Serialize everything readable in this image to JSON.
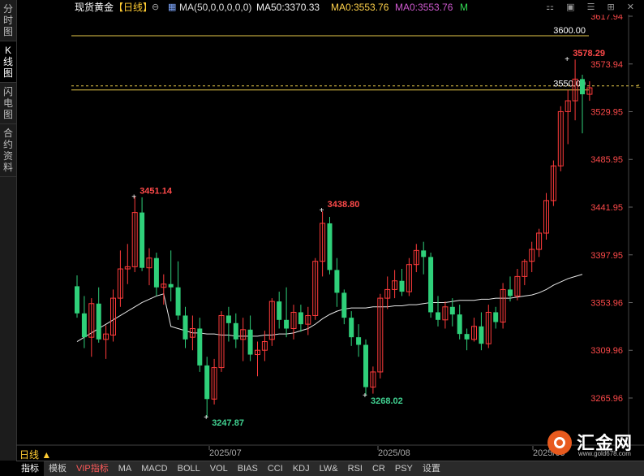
{
  "side_tabs": [
    {
      "label": [
        "分",
        "时",
        "图"
      ],
      "active": false
    },
    {
      "label": [
        "K",
        "线",
        "图"
      ],
      "active": true
    },
    {
      "label": [
        "闪",
        "电",
        "图"
      ],
      "active": false
    },
    {
      "label": [
        "合",
        "约",
        "资",
        "料"
      ],
      "active": false
    }
  ],
  "header": {
    "symbol": "现货黄金",
    "period": "【日线】",
    "ma_params": "MA(50,0,0,0,0,0)",
    "ma50": "MA50:3370.33",
    "ma0_a": "MA0:3553.76",
    "ma0_b": "MA0:3553.76",
    "m_label": "M"
  },
  "price_axis_labels": [
    "3617.94",
    "3573.94",
    "3529.95",
    "3485.95",
    "3441.95",
    "3397.95",
    "3353.96",
    "3309.96",
    "3265.96"
  ],
  "annotations": {
    "high1": "3451.14",
    "high2": "3438.80",
    "low1": "3247.87",
    "low2": "3268.02",
    "peak": "3578.29",
    "line_3600": "3600.00",
    "line_3550": "3550.00"
  },
  "date_labels": [
    "2025/07",
    "2025/08",
    "2025/09"
  ],
  "period_button": "日线 ▲",
  "bottom_tabs": [
    "指标",
    "模板",
    "VIP指标",
    "MA",
    "MACD",
    "BOLL",
    "VOL",
    "BIAS",
    "CCI",
    "KDJ",
    "LW&",
    "RSI",
    "CR",
    "PSY",
    "设置"
  ],
  "logo": {
    "name": "汇金网",
    "url": "www.gold678.com"
  },
  "colors": {
    "up": "#ff3b3b",
    "down": "#2fd07a",
    "ma50": "#e8e8e8",
    "axis_text": "#ff4a4a",
    "annotation_low": "#40d090",
    "line_level": "#e6c84a"
  },
  "chart_data": {
    "type": "candlestick",
    "title": "现货黄金 日线",
    "ylim": [
      3230,
      3630
    ],
    "candles": [
      {
        "o": 3369,
        "h": 3379,
        "l": 3340,
        "c": 3344
      },
      {
        "o": 3344,
        "h": 3360,
        "l": 3312,
        "c": 3322
      },
      {
        "o": 3322,
        "h": 3358,
        "l": 3304,
        "c": 3353
      },
      {
        "o": 3353,
        "h": 3368,
        "l": 3317,
        "c": 3320
      },
      {
        "o": 3320,
        "h": 3333,
        "l": 3302,
        "c": 3325
      },
      {
        "o": 3324,
        "h": 3366,
        "l": 3318,
        "c": 3358
      },
      {
        "o": 3358,
        "h": 3402,
        "l": 3350,
        "c": 3385
      },
      {
        "o": 3385,
        "h": 3408,
        "l": 3371,
        "c": 3387
      },
      {
        "o": 3387,
        "h": 3452,
        "l": 3382,
        "c": 3437
      },
      {
        "o": 3437,
        "h": 3451,
        "l": 3383,
        "c": 3386
      },
      {
        "o": 3386,
        "h": 3404,
        "l": 3370,
        "c": 3395
      },
      {
        "o": 3395,
        "h": 3400,
        "l": 3360,
        "c": 3368
      },
      {
        "o": 3368,
        "h": 3380,
        "l": 3352,
        "c": 3371
      },
      {
        "o": 3371,
        "h": 3402,
        "l": 3355,
        "c": 3368
      },
      {
        "o": 3368,
        "h": 3392,
        "l": 3338,
        "c": 3342
      },
      {
        "o": 3342,
        "h": 3350,
        "l": 3312,
        "c": 3320
      },
      {
        "o": 3322,
        "h": 3342,
        "l": 3310,
        "c": 3330
      },
      {
        "o": 3330,
        "h": 3340,
        "l": 3290,
        "c": 3296
      },
      {
        "o": 3296,
        "h": 3304,
        "l": 3248,
        "c": 3265
      },
      {
        "o": 3265,
        "h": 3302,
        "l": 3260,
        "c": 3294
      },
      {
        "o": 3294,
        "h": 3346,
        "l": 3290,
        "c": 3342
      },
      {
        "o": 3342,
        "h": 3350,
        "l": 3318,
        "c": 3335
      },
      {
        "o": 3335,
        "h": 3344,
        "l": 3312,
        "c": 3320
      },
      {
        "o": 3320,
        "h": 3340,
        "l": 3300,
        "c": 3329
      },
      {
        "o": 3329,
        "h": 3342,
        "l": 3300,
        "c": 3306
      },
      {
        "o": 3306,
        "h": 3318,
        "l": 3286,
        "c": 3310
      },
      {
        "o": 3310,
        "h": 3328,
        "l": 3300,
        "c": 3318
      },
      {
        "o": 3320,
        "h": 3358,
        "l": 3314,
        "c": 3355
      },
      {
        "o": 3355,
        "h": 3364,
        "l": 3330,
        "c": 3338
      },
      {
        "o": 3338,
        "h": 3368,
        "l": 3322,
        "c": 3330
      },
      {
        "o": 3330,
        "h": 3352,
        "l": 3320,
        "c": 3345
      },
      {
        "o": 3345,
        "h": 3352,
        "l": 3327,
        "c": 3334
      },
      {
        "o": 3334,
        "h": 3350,
        "l": 3324,
        "c": 3342
      },
      {
        "o": 3342,
        "h": 3395,
        "l": 3338,
        "c": 3392
      },
      {
        "o": 3392,
        "h": 3438,
        "l": 3378,
        "c": 3427
      },
      {
        "o": 3427,
        "h": 3433,
        "l": 3380,
        "c": 3384
      },
      {
        "o": 3384,
        "h": 3395,
        "l": 3350,
        "c": 3363
      },
      {
        "o": 3363,
        "h": 3366,
        "l": 3334,
        "c": 3340
      },
      {
        "o": 3340,
        "h": 3346,
        "l": 3314,
        "c": 3322
      },
      {
        "o": 3322,
        "h": 3334,
        "l": 3304,
        "c": 3315
      },
      {
        "o": 3315,
        "h": 3320,
        "l": 3268,
        "c": 3276
      },
      {
        "o": 3276,
        "h": 3295,
        "l": 3270,
        "c": 3290
      },
      {
        "o": 3290,
        "h": 3362,
        "l": 3284,
        "c": 3358
      },
      {
        "o": 3358,
        "h": 3378,
        "l": 3348,
        "c": 3366
      },
      {
        "o": 3366,
        "h": 3384,
        "l": 3358,
        "c": 3374
      },
      {
        "o": 3374,
        "h": 3385,
        "l": 3360,
        "c": 3364
      },
      {
        "o": 3364,
        "h": 3395,
        "l": 3360,
        "c": 3389
      },
      {
        "o": 3389,
        "h": 3408,
        "l": 3382,
        "c": 3402
      },
      {
        "o": 3402,
        "h": 3410,
        "l": 3380,
        "c": 3396
      },
      {
        "o": 3396,
        "h": 3400,
        "l": 3340,
        "c": 3345
      },
      {
        "o": 3345,
        "h": 3360,
        "l": 3332,
        "c": 3338
      },
      {
        "o": 3338,
        "h": 3355,
        "l": 3330,
        "c": 3350
      },
      {
        "o": 3350,
        "h": 3358,
        "l": 3332,
        "c": 3343
      },
      {
        "o": 3343,
        "h": 3352,
        "l": 3320,
        "c": 3325
      },
      {
        "o": 3325,
        "h": 3330,
        "l": 3310,
        "c": 3320
      },
      {
        "o": 3320,
        "h": 3340,
        "l": 3318,
        "c": 3332
      },
      {
        "o": 3332,
        "h": 3345,
        "l": 3310,
        "c": 3316
      },
      {
        "o": 3316,
        "h": 3352,
        "l": 3312,
        "c": 3345
      },
      {
        "o": 3345,
        "h": 3350,
        "l": 3330,
        "c": 3336
      },
      {
        "o": 3336,
        "h": 3372,
        "l": 3330,
        "c": 3366
      },
      {
        "o": 3366,
        "h": 3378,
        "l": 3355,
        "c": 3360
      },
      {
        "o": 3360,
        "h": 3385,
        "l": 3356,
        "c": 3378
      },
      {
        "o": 3378,
        "h": 3394,
        "l": 3370,
        "c": 3392
      },
      {
        "o": 3392,
        "h": 3410,
        "l": 3382,
        "c": 3403
      },
      {
        "o": 3403,
        "h": 3422,
        "l": 3396,
        "c": 3418
      },
      {
        "o": 3418,
        "h": 3455,
        "l": 3412,
        "c": 3448
      },
      {
        "o": 3448,
        "h": 3485,
        "l": 3443,
        "c": 3480
      },
      {
        "o": 3480,
        "h": 3535,
        "l": 3475,
        "c": 3530
      },
      {
        "o": 3530,
        "h": 3550,
        "l": 3500,
        "c": 3540
      },
      {
        "o": 3540,
        "h": 3578,
        "l": 3522,
        "c": 3560
      },
      {
        "o": 3560,
        "h": 3564,
        "l": 3510,
        "c": 3546
      },
      {
        "o": 3546,
        "h": 3558,
        "l": 3540,
        "c": 3552
      }
    ],
    "ma50": [
      3318,
      3322,
      3326,
      3330,
      3334,
      3338,
      3342,
      3346,
      3350,
      3354,
      3357,
      3360,
      3362,
      3332,
      3330,
      3328,
      3326,
      3326,
      3325,
      3325,
      3324,
      3324,
      3323,
      3323,
      3323,
      3323,
      3324,
      3324,
      3325,
      3325,
      3326,
      3328,
      3330,
      3334,
      3339,
      3343,
      3346,
      3348,
      3349,
      3349,
      3349,
      3350,
      3350,
      3350,
      3351,
      3351,
      3352,
      3352,
      3353,
      3354,
      3354,
      3354,
      3355,
      3356,
      3356,
      3356,
      3357,
      3357,
      3358,
      3358,
      3358,
      3359,
      3360,
      3361,
      3363,
      3366,
      3370,
      3373,
      3376,
      3378,
      3380
    ]
  }
}
